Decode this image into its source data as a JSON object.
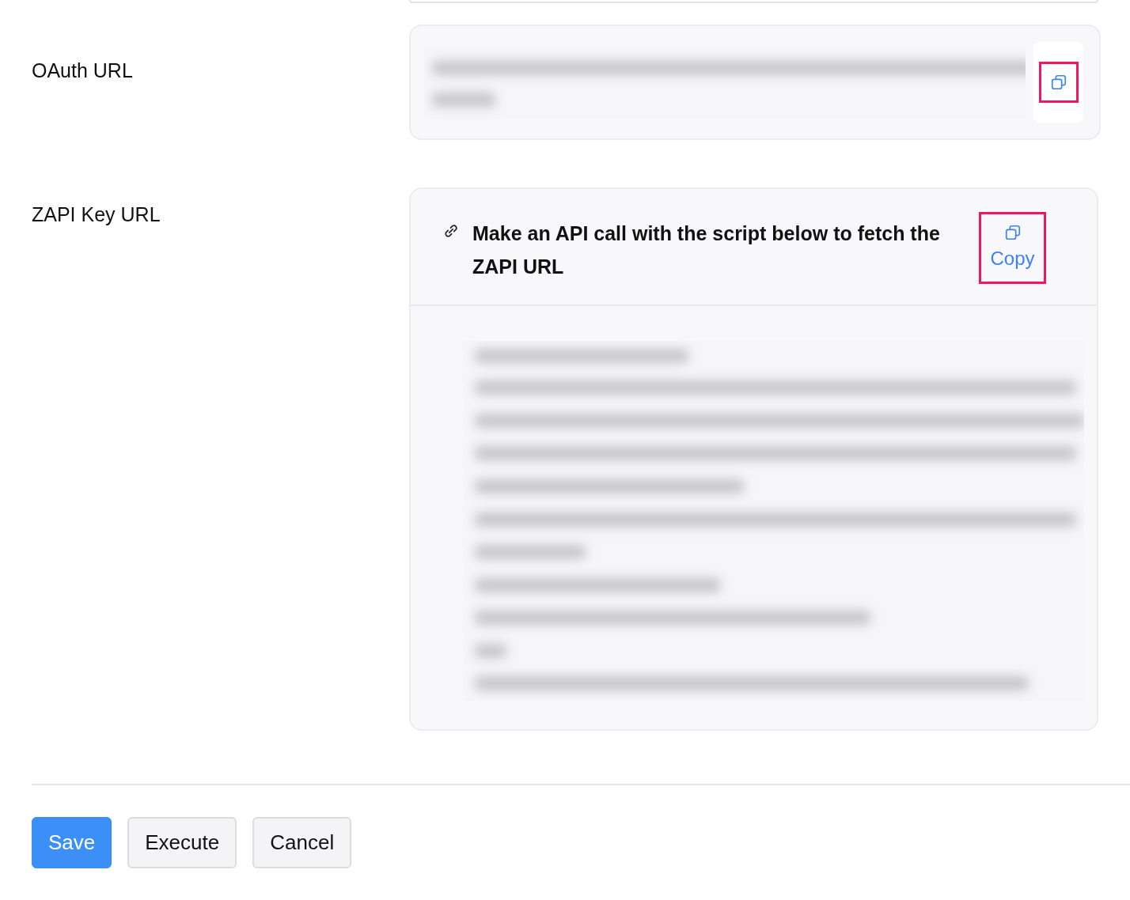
{
  "oauth": {
    "label": "OAuth URL"
  },
  "zapi": {
    "label": "ZAPI Key URL",
    "instruction": "Make an API call with the script below to fetch the ZAPI URL",
    "copy_label": "Copy"
  },
  "buttons": [
    {
      "label": "Save",
      "kind": "primary"
    },
    {
      "label": "Execute",
      "kind": "secondary"
    },
    {
      "label": "Cancel",
      "kind": "secondary"
    }
  ]
}
